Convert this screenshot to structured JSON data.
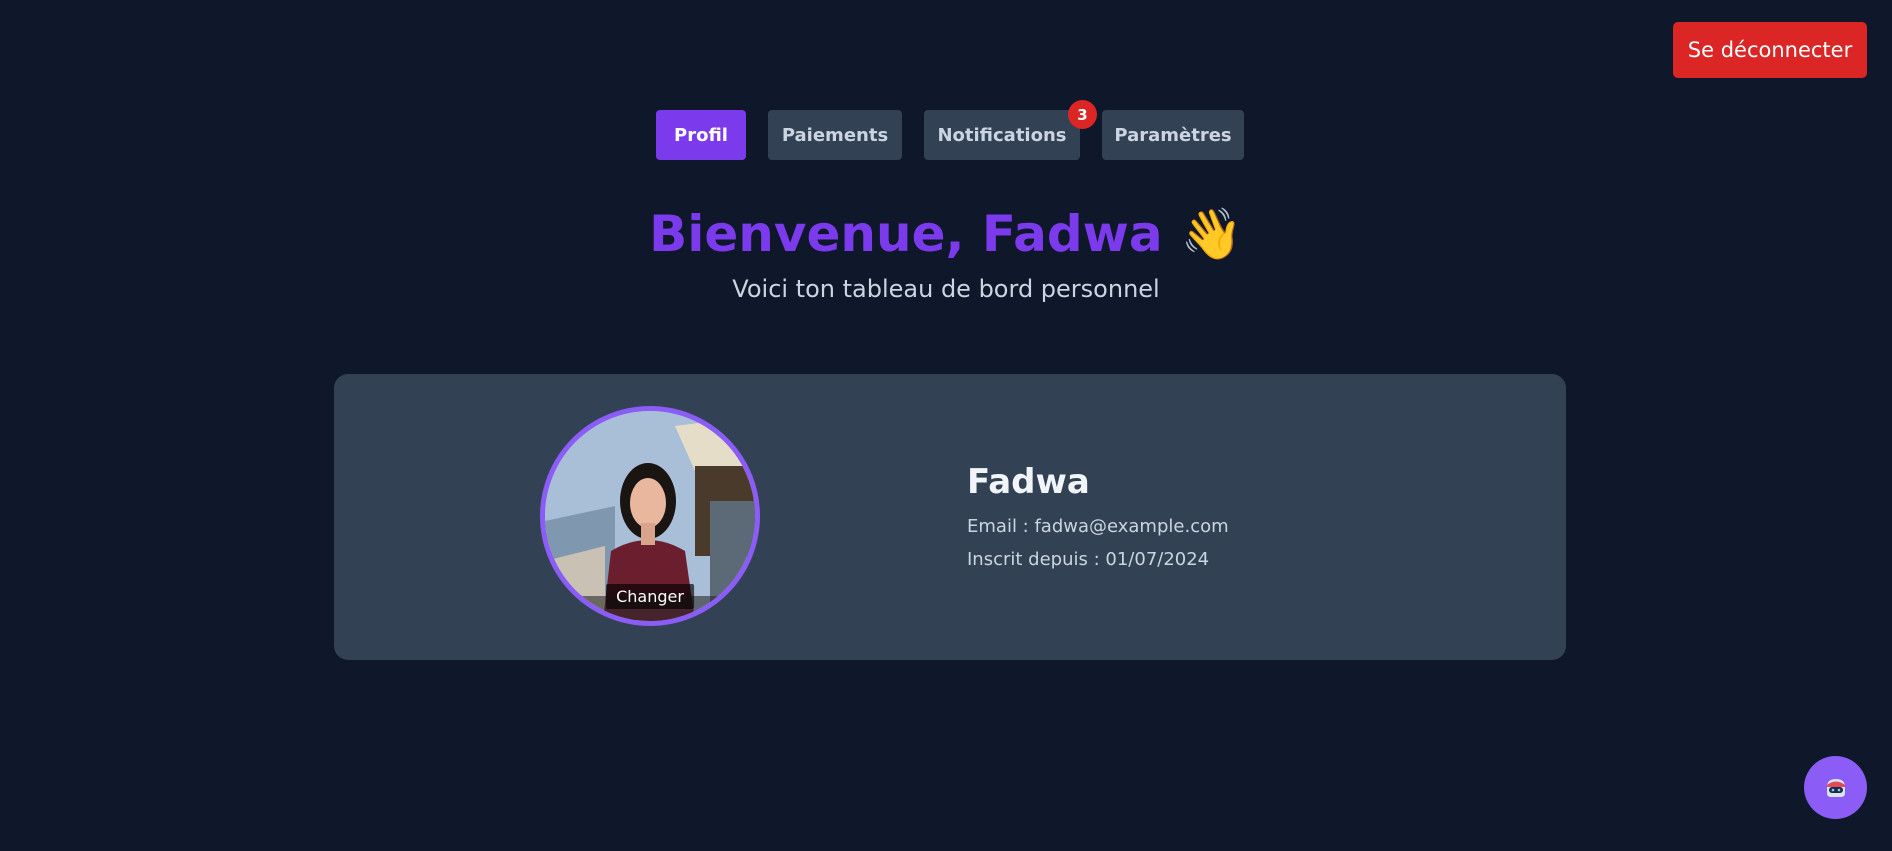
{
  "header": {
    "logout_label": "Se déconnecter"
  },
  "tabs": [
    {
      "label": "Profil",
      "active": true
    },
    {
      "label": "Paiements",
      "active": false
    },
    {
      "label": "Notifications",
      "active": false,
      "badge": "3"
    },
    {
      "label": "Paramètres",
      "active": false
    }
  ],
  "hero": {
    "title": "Bienvenue, Fadwa",
    "emoji": "👋",
    "subtitle": "Voici ton tableau de bord personnel"
  },
  "profile": {
    "change_label": "Changer",
    "name": "Fadwa",
    "email_line": "Email : fadwa@example.com",
    "since_line": "Inscrit depuis : 01/07/2024"
  },
  "colors": {
    "background": "#0f172a",
    "accent": "#7c3aed",
    "card": "#334155",
    "danger": "#dc2626"
  },
  "icons": {
    "chat_button": "robot-icon",
    "greeting": "waving-hand-icon"
  }
}
